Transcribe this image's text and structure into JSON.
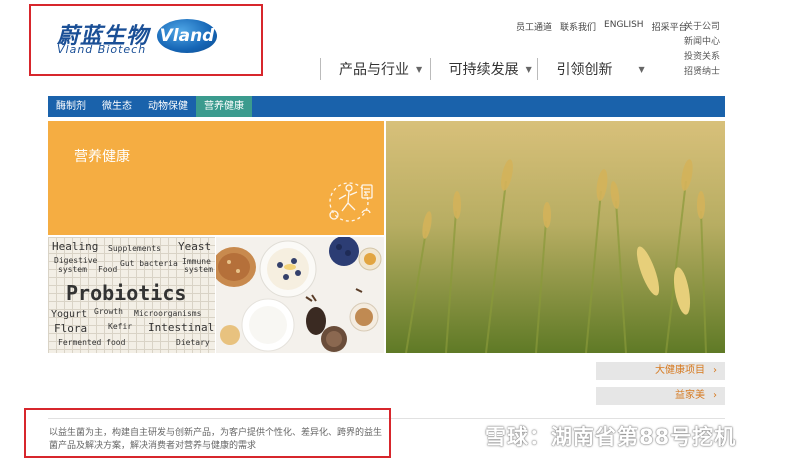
{
  "brand": {
    "name_cn": "蔚蓝生物",
    "name_en": "Vland Biotech",
    "badge": "Vland"
  },
  "utility_nav": [
    "员工通道",
    "联系我们",
    "ENGLISH",
    "招采平台"
  ],
  "side_links": [
    "关于公司",
    "新闻中心",
    "投资关系",
    "招贤纳士"
  ],
  "main_nav": [
    {
      "label": "产品与行业"
    },
    {
      "label": "可持续发展"
    },
    {
      "label": "引领创新"
    }
  ],
  "tabs": [
    {
      "label": "酶制剂",
      "active": false
    },
    {
      "label": "微生态",
      "active": false
    },
    {
      "label": "动物保健",
      "active": false
    },
    {
      "label": "营养健康",
      "active": true
    }
  ],
  "hero": {
    "title": "营养健康",
    "probiotics_words": {
      "healing": "Healing",
      "supplements": "Supplements",
      "yeast": "Yeast",
      "digestive": "Digestive",
      "system": "system",
      "food": "Food",
      "gut": "Gut bacteria",
      "immune": "Immune",
      "system2": "system",
      "title": "Probiotics",
      "yogurt": "Yogurt",
      "growth": "Growth",
      "microorganisms": "Microorganisms",
      "flora": "Flora",
      "kefir": "Kefir",
      "intestinal": "Intestinal",
      "fermented": "Fermented food",
      "dietary": "Dietary"
    }
  },
  "side_buttons": [
    "大健康项目",
    "益家美"
  ],
  "description": "以益生菌为主，构建自主研发与创新产品，为客户提供个性化、差异化、跨界的益生菌产品及解决方案，解决消费者对营养与健康的需求",
  "watermark": "雪球：湖南省第88号挖机",
  "colors": {
    "primary_blue": "#1a62ab",
    "active_tab": "#3b9b8e",
    "orange": "#f5ad42",
    "highlight_red": "#d7262c"
  }
}
